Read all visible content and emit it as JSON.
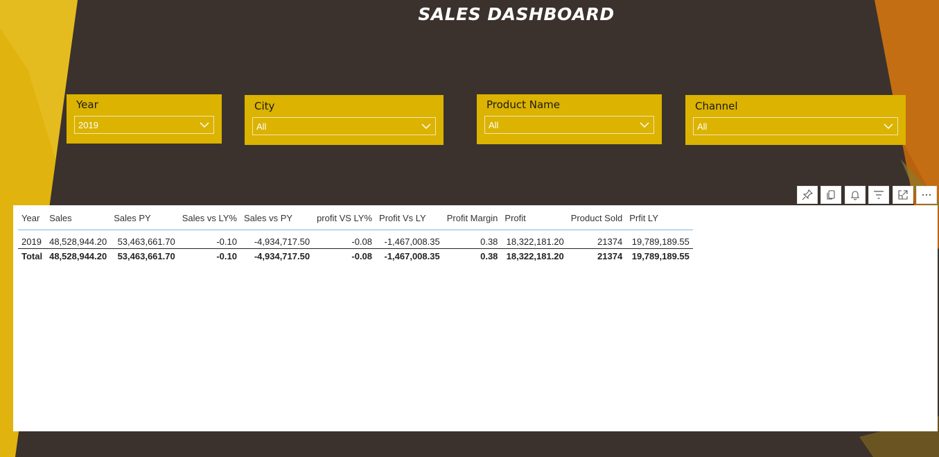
{
  "dashboard": {
    "title": "SALES DASHBOARD"
  },
  "theme": {
    "background": "#3b322d",
    "slicer_bg": "#dbb300",
    "left_accent": "#e0b30f",
    "right_accent": "#b8620f",
    "panel_bg": "#ffffff"
  },
  "slicers": [
    {
      "label": "Year",
      "value": "2019"
    },
    {
      "label": "City",
      "value": "All"
    },
    {
      "label": "Product Name",
      "value": "All"
    },
    {
      "label": "Channel",
      "value": "All"
    }
  ],
  "toolbar": {
    "icons": [
      "pin-icon",
      "copy-icon",
      "bell-icon",
      "filter-icon",
      "focus-mode-icon",
      "more-options-icon"
    ]
  },
  "table": {
    "headers": [
      "Year",
      "Sales",
      "Sales PY",
      "Sales vs LY%",
      "Sales vs PY",
      "profit VS LY%",
      "Profit Vs LY",
      "Profit Margin",
      "Profit",
      "Product Sold",
      "Prfit LY"
    ],
    "rows": [
      [
        "2019",
        "48,528,944.20",
        "53,463,661.70",
        "-0.10",
        "-4,934,717.50",
        "-0.08",
        "-1,467,008.35",
        "0.38",
        "18,322,181.20",
        "21374",
        "19,789,189.55"
      ]
    ],
    "total": [
      "Total",
      "48,528,944.20",
      "53,463,661.70",
      "-0.10",
      "-4,934,717.50",
      "-0.08",
      "-1,467,008.35",
      "0.38",
      "18,322,181.20",
      "21374",
      "19,789,189.55"
    ]
  }
}
